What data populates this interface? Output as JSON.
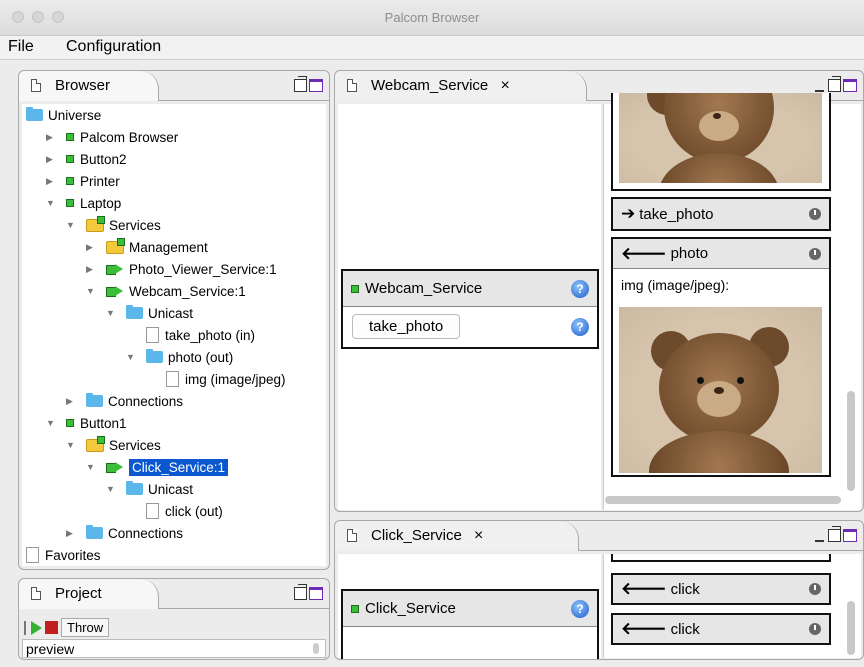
{
  "window": {
    "title": "Palcom Browser"
  },
  "menu": [
    "File",
    "Configuration"
  ],
  "browser": {
    "tab": "Browser",
    "tree": [
      {
        "label": "Universe",
        "icon": "folder",
        "level": 0,
        "tw": ""
      },
      {
        "label": "Palcom Browser",
        "icon": "green",
        "level": 1,
        "tw": "▶"
      },
      {
        "label": "Button2",
        "icon": "green",
        "level": 1,
        "tw": "▶"
      },
      {
        "label": "Printer",
        "icon": "green",
        "level": 1,
        "tw": "▶"
      },
      {
        "label": "Laptop",
        "icon": "green",
        "level": 1,
        "tw": "▼"
      },
      {
        "label": "Services",
        "icon": "ofolder",
        "level": 2,
        "tw": "▼"
      },
      {
        "label": "Management",
        "icon": "ofolder",
        "level": 3,
        "tw": "▶"
      },
      {
        "label": "Photo_Viewer_Service:1",
        "icon": "svc",
        "level": 3,
        "tw": "▶"
      },
      {
        "label": "Webcam_Service:1",
        "icon": "svc",
        "level": 3,
        "tw": "▼"
      },
      {
        "label": "Unicast",
        "icon": "folder",
        "level": 4,
        "tw": "▼"
      },
      {
        "label": "take_photo (in)",
        "icon": "doc",
        "level": 5,
        "tw": ""
      },
      {
        "label": "photo (out)",
        "icon": "folder",
        "level": 5,
        "tw": "▼"
      },
      {
        "label": "img (image/jpeg)",
        "icon": "doc",
        "level": 6,
        "tw": ""
      },
      {
        "label": "Connections",
        "icon": "folder",
        "level": 2,
        "tw": "▶"
      },
      {
        "label": "Button1",
        "icon": "green",
        "level": 1,
        "tw": "▼"
      },
      {
        "label": "Services",
        "icon": "ofolder",
        "level": 2,
        "tw": "▼"
      },
      {
        "label": "Click_Service:1",
        "icon": "svc",
        "level": 3,
        "tw": "▼",
        "selected": true
      },
      {
        "label": "Unicast",
        "icon": "folder",
        "level": 4,
        "tw": "▼"
      },
      {
        "label": "click (out)",
        "icon": "doc",
        "level": 5,
        "tw": ""
      },
      {
        "label": "Connections",
        "icon": "folder",
        "level": 2,
        "tw": "▶"
      },
      {
        "label": "Favorites",
        "icon": "doc",
        "level": 0,
        "tw": ""
      }
    ]
  },
  "project": {
    "tab": "Project",
    "throw_label": "Throw",
    "preview_label": "preview"
  },
  "webcam_panel": {
    "tab": "Webcam_Service",
    "service_name": "Webcam_Service",
    "take_photo_button": "take_photo",
    "take_photo_cmd": "take_photo",
    "photo_cmd": "photo",
    "img_label": "img (image/jpeg):"
  },
  "click_panel": {
    "tab": "Click_Service",
    "service_name": "Click_Service",
    "click_cmd_1": "click",
    "click_cmd_2": "click"
  },
  "icons": {
    "close": "×",
    "arrow_right": "➔",
    "arrow_left": "🡐",
    "help": "?"
  }
}
